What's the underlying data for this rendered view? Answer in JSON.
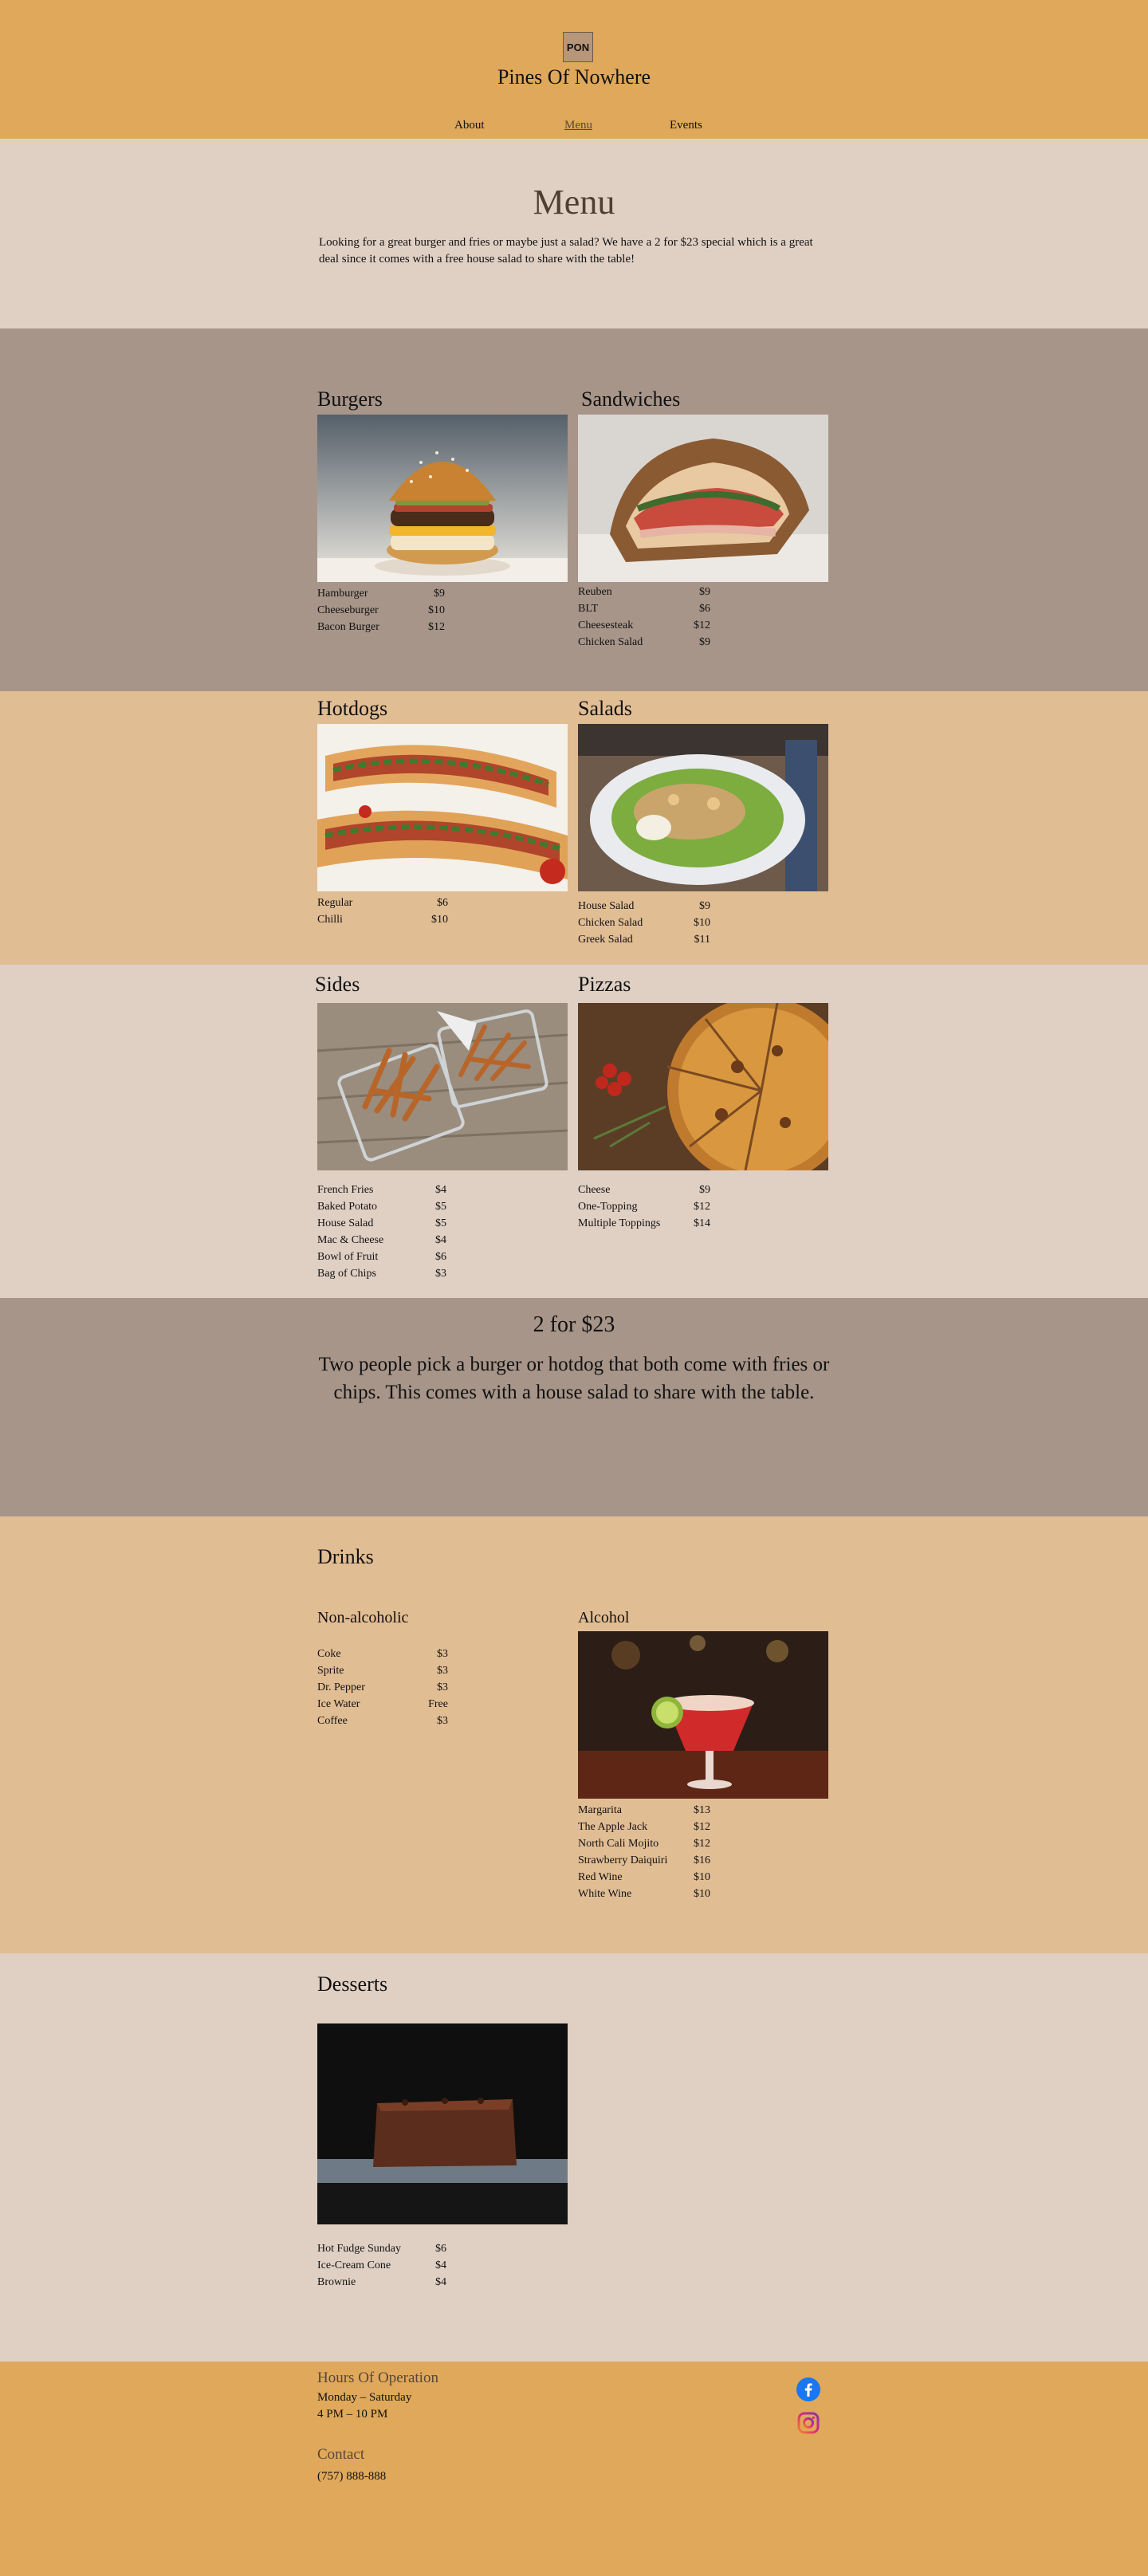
{
  "header": {
    "logo_text": "PON",
    "site_title": "Pines Of Nowhere",
    "nav": [
      {
        "label": "About"
      },
      {
        "label": "Menu"
      },
      {
        "label": "Events"
      }
    ]
  },
  "intro": {
    "heading": "Menu",
    "text": "Looking for a great burger and fries or maybe just a salad? We have a 2 for $23 special which is a great deal since it comes with a free house salad to share with the table!"
  },
  "categories": {
    "burgers": {
      "title": "Burgers",
      "items": [
        {
          "name": "Hamburger",
          "price": "$9"
        },
        {
          "name": "Cheeseburger",
          "price": "$10"
        },
        {
          "name": "Bacon Burger",
          "price": "$12"
        }
      ]
    },
    "sandwiches": {
      "title": "Sandwiches",
      "items": [
        {
          "name": "Reuben",
          "price": "$9"
        },
        {
          "name": "BLT",
          "price": "$6"
        },
        {
          "name": "Cheesesteak",
          "price": "$12"
        },
        {
          "name": "Chicken Salad",
          "price": "$9"
        }
      ]
    },
    "hotdogs": {
      "title": "Hotdogs",
      "items": [
        {
          "name": "Regular",
          "price": "$6"
        },
        {
          "name": "Chilli",
          "price": "$10"
        }
      ]
    },
    "salads": {
      "title": "Salads",
      "items": [
        {
          "name": "House Salad",
          "price": "$9"
        },
        {
          "name": "Chicken Salad",
          "price": "$10"
        },
        {
          "name": "Greek Salad",
          "price": "$11"
        }
      ]
    },
    "sides": {
      "title": "Sides",
      "items": [
        {
          "name": "French Fries",
          "price": "$4"
        },
        {
          "name": "Baked Potato",
          "price": "$5"
        },
        {
          "name": "House Salad",
          "price": "$5"
        },
        {
          "name": "Mac & Cheese",
          "price": "$4"
        },
        {
          "name": "Bowl of Fruit",
          "price": "$6"
        },
        {
          "name": "Bag of Chips",
          "price": "$3"
        }
      ]
    },
    "pizzas": {
      "title": "Pizzas",
      "items": [
        {
          "name": "Cheese",
          "price": "$9"
        },
        {
          "name": "One-Topping",
          "price": "$12"
        },
        {
          "name": "Multiple Toppings",
          "price": "$14"
        }
      ]
    }
  },
  "special": {
    "title": "2 for $23",
    "text": "Two people pick a burger or hotdog that both come with fries or chips. This comes with a house salad to share with the table."
  },
  "drinks": {
    "title": "Drinks",
    "non_alcoholic": {
      "title": "Non-alcoholic",
      "items": [
        {
          "name": "Coke",
          "price": "$3"
        },
        {
          "name": "Sprite",
          "price": "$3"
        },
        {
          "name": "Dr. Pepper",
          "price": "$3"
        },
        {
          "name": "Ice Water",
          "price": "Free"
        },
        {
          "name": "Coffee",
          "price": "$3"
        }
      ]
    },
    "alcohol": {
      "title": "Alcohol",
      "items": [
        {
          "name": "Margarita",
          "price": "$13"
        },
        {
          "name": "The Apple Jack",
          "price": "$12"
        },
        {
          "name": "North Cali Mojito",
          "price": "$12"
        },
        {
          "name": "Strawberry Daiquiri",
          "price": "$16"
        },
        {
          "name": "Red Wine",
          "price": "$10"
        },
        {
          "name": "White Wine",
          "price": "$10"
        }
      ]
    }
  },
  "desserts": {
    "title": "Desserts",
    "items": [
      {
        "name": "Hot Fudge Sunday",
        "price": "$6"
      },
      {
        "name": "Ice-Cream Cone",
        "price": "$4"
      },
      {
        "name": "Brownie",
        "price": "$4"
      }
    ]
  },
  "footer": {
    "hours_title": "Hours Of Operation",
    "hours_days": "Monday  – Saturday",
    "hours_time": "4 PM  – 10 PM",
    "contact_title": "Contact",
    "phone": "(757) 888-888",
    "social": [
      {
        "icon": "facebook-icon"
      },
      {
        "icon": "instagram-icon"
      }
    ]
  },
  "colors": {
    "orange": "#dfa85a",
    "light": "#e0d0c4",
    "gray": "#a79589",
    "tan": "#e1bd94",
    "brown_text": "#5a4637"
  }
}
